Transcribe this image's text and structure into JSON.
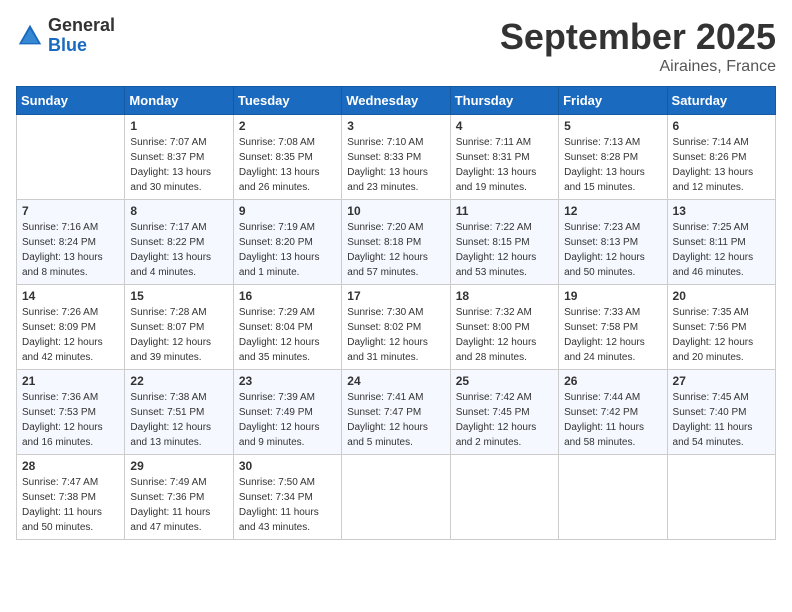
{
  "logo": {
    "general": "General",
    "blue": "Blue"
  },
  "title": "September 2025",
  "location": "Airaines, France",
  "days_of_week": [
    "Sunday",
    "Monday",
    "Tuesday",
    "Wednesday",
    "Thursday",
    "Friday",
    "Saturday"
  ],
  "weeks": [
    [
      {
        "day": "",
        "info": ""
      },
      {
        "day": "1",
        "info": "Sunrise: 7:07 AM\nSunset: 8:37 PM\nDaylight: 13 hours and 30 minutes."
      },
      {
        "day": "2",
        "info": "Sunrise: 7:08 AM\nSunset: 8:35 PM\nDaylight: 13 hours and 26 minutes."
      },
      {
        "day": "3",
        "info": "Sunrise: 7:10 AM\nSunset: 8:33 PM\nDaylight: 13 hours and 23 minutes."
      },
      {
        "day": "4",
        "info": "Sunrise: 7:11 AM\nSunset: 8:31 PM\nDaylight: 13 hours and 19 minutes."
      },
      {
        "day": "5",
        "info": "Sunrise: 7:13 AM\nSunset: 8:28 PM\nDaylight: 13 hours and 15 minutes."
      },
      {
        "day": "6",
        "info": "Sunrise: 7:14 AM\nSunset: 8:26 PM\nDaylight: 13 hours and 12 minutes."
      }
    ],
    [
      {
        "day": "7",
        "info": "Sunrise: 7:16 AM\nSunset: 8:24 PM\nDaylight: 13 hours and 8 minutes."
      },
      {
        "day": "8",
        "info": "Sunrise: 7:17 AM\nSunset: 8:22 PM\nDaylight: 13 hours and 4 minutes."
      },
      {
        "day": "9",
        "info": "Sunrise: 7:19 AM\nSunset: 8:20 PM\nDaylight: 13 hours and 1 minute."
      },
      {
        "day": "10",
        "info": "Sunrise: 7:20 AM\nSunset: 8:18 PM\nDaylight: 12 hours and 57 minutes."
      },
      {
        "day": "11",
        "info": "Sunrise: 7:22 AM\nSunset: 8:15 PM\nDaylight: 12 hours and 53 minutes."
      },
      {
        "day": "12",
        "info": "Sunrise: 7:23 AM\nSunset: 8:13 PM\nDaylight: 12 hours and 50 minutes."
      },
      {
        "day": "13",
        "info": "Sunrise: 7:25 AM\nSunset: 8:11 PM\nDaylight: 12 hours and 46 minutes."
      }
    ],
    [
      {
        "day": "14",
        "info": "Sunrise: 7:26 AM\nSunset: 8:09 PM\nDaylight: 12 hours and 42 minutes."
      },
      {
        "day": "15",
        "info": "Sunrise: 7:28 AM\nSunset: 8:07 PM\nDaylight: 12 hours and 39 minutes."
      },
      {
        "day": "16",
        "info": "Sunrise: 7:29 AM\nSunset: 8:04 PM\nDaylight: 12 hours and 35 minutes."
      },
      {
        "day": "17",
        "info": "Sunrise: 7:30 AM\nSunset: 8:02 PM\nDaylight: 12 hours and 31 minutes."
      },
      {
        "day": "18",
        "info": "Sunrise: 7:32 AM\nSunset: 8:00 PM\nDaylight: 12 hours and 28 minutes."
      },
      {
        "day": "19",
        "info": "Sunrise: 7:33 AM\nSunset: 7:58 PM\nDaylight: 12 hours and 24 minutes."
      },
      {
        "day": "20",
        "info": "Sunrise: 7:35 AM\nSunset: 7:56 PM\nDaylight: 12 hours and 20 minutes."
      }
    ],
    [
      {
        "day": "21",
        "info": "Sunrise: 7:36 AM\nSunset: 7:53 PM\nDaylight: 12 hours and 16 minutes."
      },
      {
        "day": "22",
        "info": "Sunrise: 7:38 AM\nSunset: 7:51 PM\nDaylight: 12 hours and 13 minutes."
      },
      {
        "day": "23",
        "info": "Sunrise: 7:39 AM\nSunset: 7:49 PM\nDaylight: 12 hours and 9 minutes."
      },
      {
        "day": "24",
        "info": "Sunrise: 7:41 AM\nSunset: 7:47 PM\nDaylight: 12 hours and 5 minutes."
      },
      {
        "day": "25",
        "info": "Sunrise: 7:42 AM\nSunset: 7:45 PM\nDaylight: 12 hours and 2 minutes."
      },
      {
        "day": "26",
        "info": "Sunrise: 7:44 AM\nSunset: 7:42 PM\nDaylight: 11 hours and 58 minutes."
      },
      {
        "day": "27",
        "info": "Sunrise: 7:45 AM\nSunset: 7:40 PM\nDaylight: 11 hours and 54 minutes."
      }
    ],
    [
      {
        "day": "28",
        "info": "Sunrise: 7:47 AM\nSunset: 7:38 PM\nDaylight: 11 hours and 50 minutes."
      },
      {
        "day": "29",
        "info": "Sunrise: 7:49 AM\nSunset: 7:36 PM\nDaylight: 11 hours and 47 minutes."
      },
      {
        "day": "30",
        "info": "Sunrise: 7:50 AM\nSunset: 7:34 PM\nDaylight: 11 hours and 43 minutes."
      },
      {
        "day": "",
        "info": ""
      },
      {
        "day": "",
        "info": ""
      },
      {
        "day": "",
        "info": ""
      },
      {
        "day": "",
        "info": ""
      }
    ]
  ]
}
